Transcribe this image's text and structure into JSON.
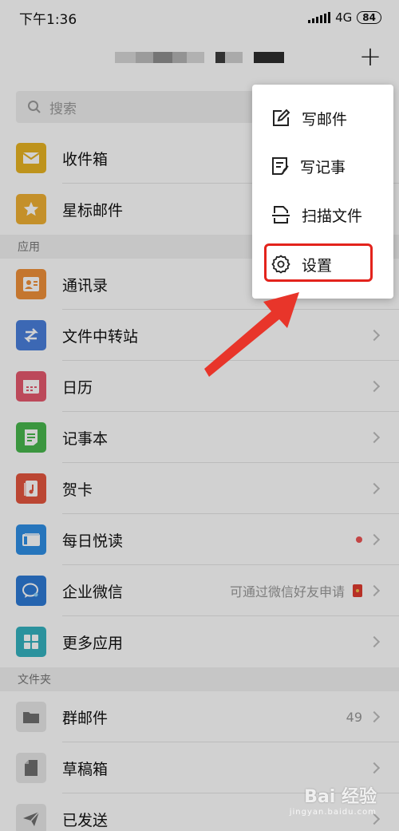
{
  "status": {
    "time": "下午1:36",
    "network": "4G",
    "battery": "84"
  },
  "search": {
    "placeholder": "搜索"
  },
  "mail_items": [
    {
      "label": "收件箱",
      "icon": "inbox-icon",
      "color": "#e8b423"
    },
    {
      "label": "星标邮件",
      "icon": "star-icon",
      "color": "#f0b034"
    }
  ],
  "sections": {
    "apps": "应用",
    "folders": "文件夹"
  },
  "apps": [
    {
      "label": "通讯录",
      "icon": "contacts-icon",
      "color": "#f0913a",
      "right_text": ""
    },
    {
      "label": "文件中转站",
      "icon": "transfer-icon",
      "color": "#4a7fdc",
      "right_text": ""
    },
    {
      "label": "日历",
      "icon": "calendar-icon",
      "color": "#e65a6e",
      "right_text": ""
    },
    {
      "label": "记事本",
      "icon": "notepad-icon",
      "color": "#48b84d",
      "right_text": ""
    },
    {
      "label": "贺卡",
      "icon": "greeting-card-icon",
      "color": "#e4563f",
      "right_text": ""
    },
    {
      "label": "每日悦读",
      "icon": "reading-icon",
      "color": "#2f8fe6",
      "right_text": ""
    },
    {
      "label": "企业微信",
      "icon": "work-wechat-icon",
      "color": "#2e7ad6",
      "right_text": "可通过微信好友申请"
    },
    {
      "label": "更多应用",
      "icon": "more-apps-icon",
      "color": "#35b3c0",
      "right_text": ""
    }
  ],
  "folders": [
    {
      "label": "群邮件",
      "icon": "folder-icon",
      "right_text": "49"
    },
    {
      "label": "草稿箱",
      "icon": "draft-icon",
      "right_text": ""
    },
    {
      "label": "已发送",
      "icon": "sent-icon",
      "right_text": ""
    }
  ],
  "menu": {
    "items": [
      {
        "label": "写邮件",
        "icon": "compose-icon"
      },
      {
        "label": "写记事",
        "icon": "note-icon"
      },
      {
        "label": "扫描文件",
        "icon": "scan-icon"
      },
      {
        "label": "设置",
        "icon": "gear-icon"
      }
    ]
  },
  "watermark": {
    "main": "Bai 经验",
    "sub": "jingyan.baidu.com"
  },
  "colors": {
    "highlight": "#e3231c",
    "arrow": "#e8352a"
  }
}
